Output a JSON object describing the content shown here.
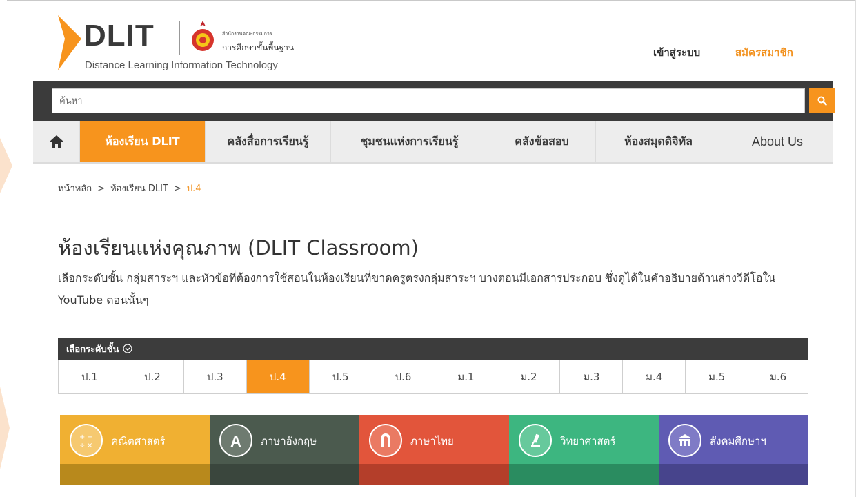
{
  "header": {
    "logo_text": "DLIT",
    "logo_subtitle": "Distance Learning Information Technology",
    "obec_line1": "สำนักงานคณะกรรมการ",
    "obec_line2": "การศึกษาขั้นพื้นฐาน",
    "login_label": "เข้าสู่ระบบ",
    "register_label": "สมัครสมาชิก"
  },
  "search": {
    "placeholder": "ค้นหา"
  },
  "nav": {
    "items": [
      {
        "label": "ห้องเรียน DLIT"
      },
      {
        "label": "คลังสื่อการเรียนรู้"
      },
      {
        "label": "ชุมชนแห่งการเรียนรู้"
      },
      {
        "label": "คลังข้อสอบ"
      },
      {
        "label": "ห้องสมุดดิจิทัล"
      },
      {
        "label": "About Us"
      }
    ]
  },
  "breadcrumb": {
    "items": [
      "หน้าหลัก",
      "ห้องเรียน DLIT",
      "ป.4"
    ],
    "separator": ">"
  },
  "page": {
    "title": "ห้องเรียนแห่งคุณภาพ (DLIT Classroom)",
    "description": "เลือกระดับชั้น กลุ่มสาระฯ และหัวข้อที่ต้องการใช้สอนในห้องเรียนที่ขาดครูตรงกลุ่มสาระฯ บางตอนมีเอกสารประกอบ ซึ่งดูได้ในคำอธิบายด้านล่างวีดีโอใน YouTube ตอนนั้นๆ"
  },
  "grades": {
    "header": "เลือกระดับชั้น",
    "selected": "ป.4",
    "items": [
      "ป.1",
      "ป.2",
      "ป.3",
      "ป.4",
      "ป.5",
      "ป.6",
      "ม.1",
      "ม.2",
      "ม.3",
      "ม.4",
      "ม.5",
      "ม.6"
    ]
  },
  "subjects": [
    {
      "label": "คณิตศาสตร์",
      "icon": "math-icon",
      "color": "#f0b032",
      "band": "#b8891c"
    },
    {
      "label": "ภาษาอังกฤษ",
      "icon": "letter-a-icon",
      "color": "#4b5a4e",
      "band": "#3a463d"
    },
    {
      "label": "ภาษาไทย",
      "icon": "thai-letter-icon",
      "color": "#e2553b",
      "band": "#b43e2a"
    },
    {
      "label": "วิทยาศาสตร์",
      "icon": "microscope-icon",
      "color": "#3db680",
      "band": "#2a8c60"
    },
    {
      "label": "สังคมศึกษาฯ",
      "icon": "temple-icon",
      "color": "#5f5bb3",
      "band": "#47448c"
    }
  ],
  "colors": {
    "accent": "#f7941d",
    "dark_bar": "#3b3b3b"
  }
}
